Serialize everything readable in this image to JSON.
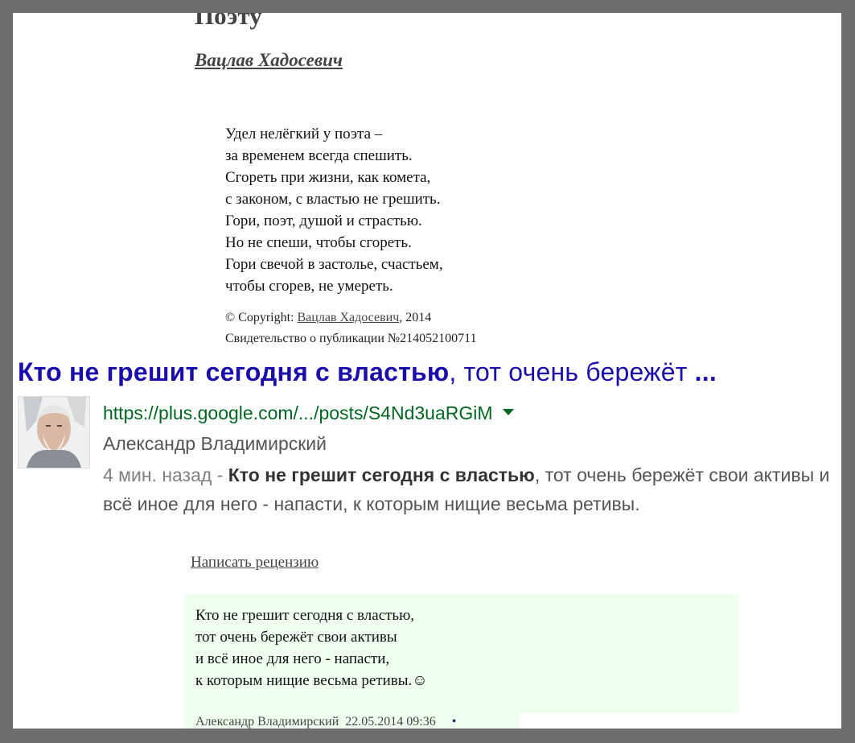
{
  "poem": {
    "title": "Поэту",
    "author": "Вацлав Хадосевич",
    "lines": [
      "Удел нелёгкий у поэта –",
      "за временем всегда спешить.",
      "Сгореть при жизни, как комета,",
      "с законом, с властью не грешить.",
      "Гори, поэт, душой и страстью.",
      "Но не спеши, чтобы сгореть.",
      "Гори свечой в застолье, счастьем,",
      "чтобы сгорев, не умереть."
    ],
    "copyright_prefix": "© Copyright: ",
    "copyright_author": "Вацлав Хадосевич",
    "copyright_year": ", 2014",
    "certificate": "Свидетельство о публикации №214052100711"
  },
  "search_result": {
    "title_bold": "Кто не грешит сегодня с властью",
    "title_rest": ", тот очень бережёт ",
    "title_ellipsis": "...",
    "url": "https://plus.google.com/.../posts/S4Nd3uaRGiM",
    "author": "Александр Владимирский",
    "time": "4 мин. назад - ",
    "snippet_bold": "Кто не грешит сегодня с властью",
    "snippet_rest": ", тот очень бережёт свои активы и всё иное для него - напасти, к которым нищие весьма ретивы."
  },
  "review": {
    "link": "Написать рецензию",
    "lines": [
      "Кто не грешит сегодня с властью,",
      "тот очень бережёт свои активы",
      "и всё иное для него - напасти,",
      "к которым нищие весьма ретивы.☺"
    ],
    "meta_author": "Александр Владимирский",
    "meta_date": "22.05.2014 09:36",
    "meta_bullet": "•"
  },
  "colors": {
    "frame": "#6d6d6d",
    "link_title": "#1a0dab",
    "url_green": "#006621",
    "review_bg": "#efffef"
  }
}
